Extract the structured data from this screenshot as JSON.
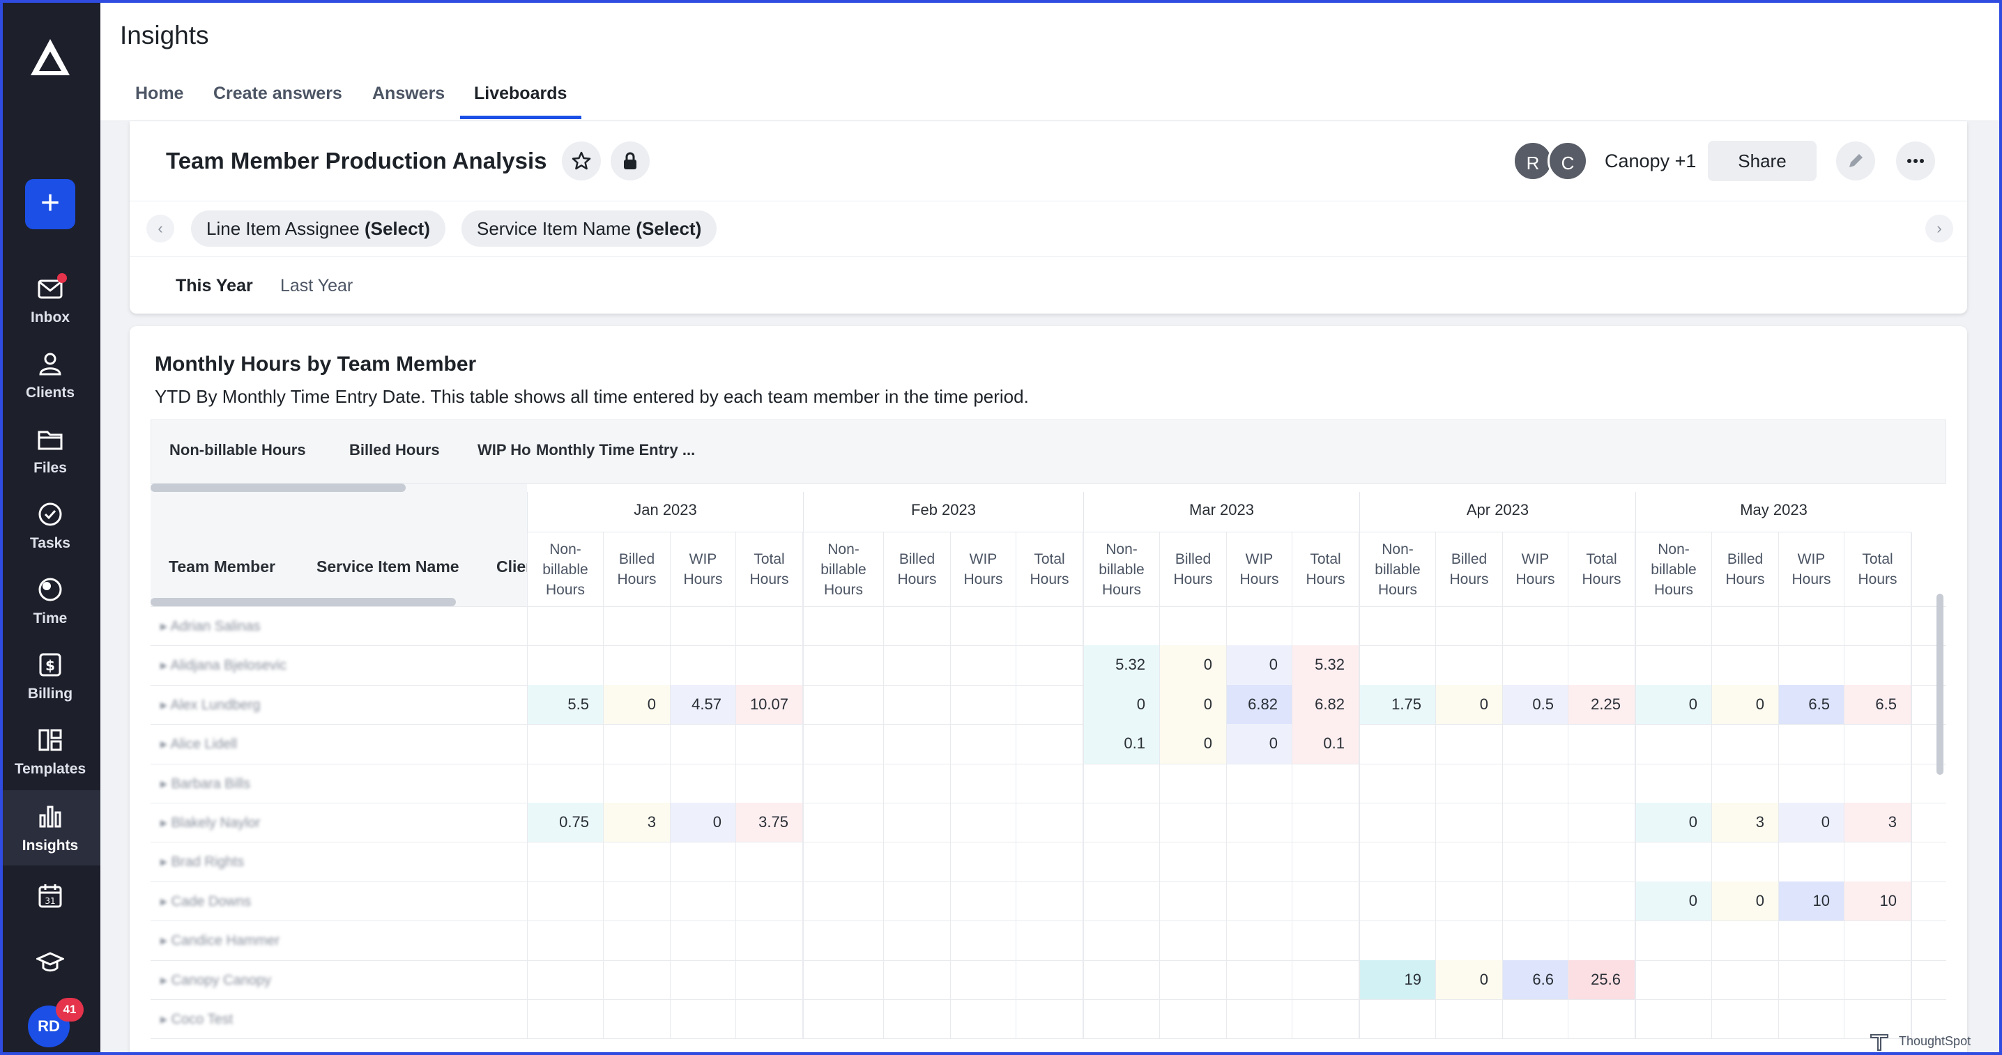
{
  "app": {
    "title": "Insights"
  },
  "tabs": [
    {
      "label": "Home"
    },
    {
      "label": "Create answers"
    },
    {
      "label": "Answers"
    },
    {
      "label": "Liveboards"
    }
  ],
  "sidebar": {
    "items": [
      {
        "label": "Inbox",
        "icon": "mail-icon"
      },
      {
        "label": "Clients",
        "icon": "users-icon"
      },
      {
        "label": "Files",
        "icon": "folder-icon"
      },
      {
        "label": "Tasks",
        "icon": "check-circle-icon"
      },
      {
        "label": "Time",
        "icon": "clock-icon"
      },
      {
        "label": "Billing",
        "icon": "dollar-icon"
      },
      {
        "label": "Templates",
        "icon": "templates-icon"
      },
      {
        "label": "Insights",
        "icon": "bar-chart-icon"
      }
    ],
    "user_initials": "RD",
    "notification_count": "41"
  },
  "liveboard": {
    "title": "Team Member Production Analysis",
    "avatars": [
      "R",
      "C"
    ],
    "owner_label": "Canopy +1",
    "share_label": "Share",
    "filters": [
      {
        "name": "Line Item Assignee",
        "value": "(Select)"
      },
      {
        "name": "Service Item Name",
        "value": "(Select)"
      }
    ],
    "periods": [
      "This Year",
      "Last Year"
    ]
  },
  "viz": {
    "title": "Monthly Hours by Team Member",
    "description": "YTD By Monthly Time Entry Date. This table shows all time entered by each team member in the time period.",
    "tabs": [
      "Non-billable Hours",
      "Billed Hours",
      "WIP Ho",
      "Monthly Time Entry ..."
    ],
    "row_headers": [
      "Team Member",
      "Service Item Name",
      "Clien"
    ],
    "months": [
      "Jan 2023",
      "Feb 2023",
      "Mar 2023",
      "Apr 2023",
      "May 2023"
    ],
    "subcolumns": [
      "Non- billable Hours",
      "Billed Hours",
      "WIP Hours",
      "Total Hours"
    ],
    "rows": [
      {
        "name": "Adrian Salinas",
        "cells": [
          [
            "",
            "",
            "",
            ""
          ],
          [
            "",
            "",
            "",
            ""
          ],
          [
            "",
            "",
            "",
            ""
          ],
          [
            "",
            "",
            "",
            ""
          ],
          [
            "",
            "",
            "",
            ""
          ]
        ]
      },
      {
        "name": "Alidjana Bjelosevic",
        "cells": [
          [
            "",
            "",
            "",
            ""
          ],
          [
            "",
            "",
            "",
            ""
          ],
          [
            "5.32",
            "0",
            "0",
            "5.32"
          ],
          [
            "",
            "",
            "",
            ""
          ],
          [
            "",
            "",
            "",
            ""
          ]
        ]
      },
      {
        "name": "Alex Lundberg",
        "cells": [
          [
            "5.5",
            "0",
            "4.57",
            "10.07"
          ],
          [
            "",
            "",
            "",
            ""
          ],
          [
            "0",
            "0",
            "6.82",
            "6.82"
          ],
          [
            "1.75",
            "0",
            "0.5",
            "2.25"
          ],
          [
            "0",
            "0",
            "6.5",
            "6.5"
          ]
        ]
      },
      {
        "name": "Alice Lidell",
        "cells": [
          [
            "",
            "",
            "",
            ""
          ],
          [
            "",
            "",
            "",
            ""
          ],
          [
            "0.1",
            "0",
            "0",
            "0.1"
          ],
          [
            "",
            "",
            "",
            ""
          ],
          [
            "",
            "",
            "",
            ""
          ]
        ]
      },
      {
        "name": "Barbara Bills",
        "cells": [
          [
            "",
            "",
            "",
            ""
          ],
          [
            "",
            "",
            "",
            ""
          ],
          [
            "",
            "",
            "",
            ""
          ],
          [
            "",
            "",
            "",
            ""
          ],
          [
            "",
            "",
            "",
            ""
          ]
        ]
      },
      {
        "name": "Blakely Naylor",
        "cells": [
          [
            "0.75",
            "3",
            "0",
            "3.75"
          ],
          [
            "",
            "",
            "",
            ""
          ],
          [
            "",
            "",
            "",
            ""
          ],
          [
            "",
            "",
            "",
            ""
          ],
          [
            "0",
            "3",
            "0",
            "3"
          ]
        ]
      },
      {
        "name": "Brad Rights",
        "cells": [
          [
            "",
            "",
            "",
            ""
          ],
          [
            "",
            "",
            "",
            ""
          ],
          [
            "",
            "",
            "",
            ""
          ],
          [
            "",
            "",
            "",
            ""
          ],
          [
            "",
            "",
            "",
            ""
          ]
        ]
      },
      {
        "name": "Cade Downs",
        "cells": [
          [
            "",
            "",
            "",
            ""
          ],
          [
            "",
            "",
            "",
            ""
          ],
          [
            "",
            "",
            "",
            ""
          ],
          [
            "",
            "",
            "",
            ""
          ],
          [
            "0",
            "0",
            "10",
            "10"
          ]
        ]
      },
      {
        "name": "Candice Hammer",
        "cells": [
          [
            "",
            "",
            "",
            ""
          ],
          [
            "",
            "",
            "",
            ""
          ],
          [
            "",
            "",
            "",
            ""
          ],
          [
            "",
            "",
            "",
            ""
          ],
          [
            "",
            "",
            "",
            ""
          ]
        ]
      },
      {
        "name": "Canopy Canopy",
        "cells": [
          [
            "",
            "",
            "",
            ""
          ],
          [
            "",
            "",
            "",
            ""
          ],
          [
            "",
            "",
            "",
            ""
          ],
          [
            "19",
            "0",
            "6.6",
            "25.6"
          ],
          [
            "",
            "",
            "",
            ""
          ]
        ]
      },
      {
        "name": "Coco Test",
        "cells": [
          [
            "",
            "",
            "",
            ""
          ],
          [
            "",
            "",
            "",
            ""
          ],
          [
            "",
            "",
            "",
            ""
          ],
          [
            "",
            "",
            "",
            ""
          ],
          [
            "",
            "",
            "",
            ""
          ]
        ]
      }
    ]
  },
  "footer": {
    "brand": "ThoughtSpot"
  },
  "colors": {
    "accent": "#1b4fe6",
    "sidebar": "#1d1f2b",
    "nonbillable_tint": "#eaf8fa",
    "billed_tint": "#fdfbef",
    "wip_tint": "#eef1fc",
    "total_tint": "#fdeef0"
  }
}
